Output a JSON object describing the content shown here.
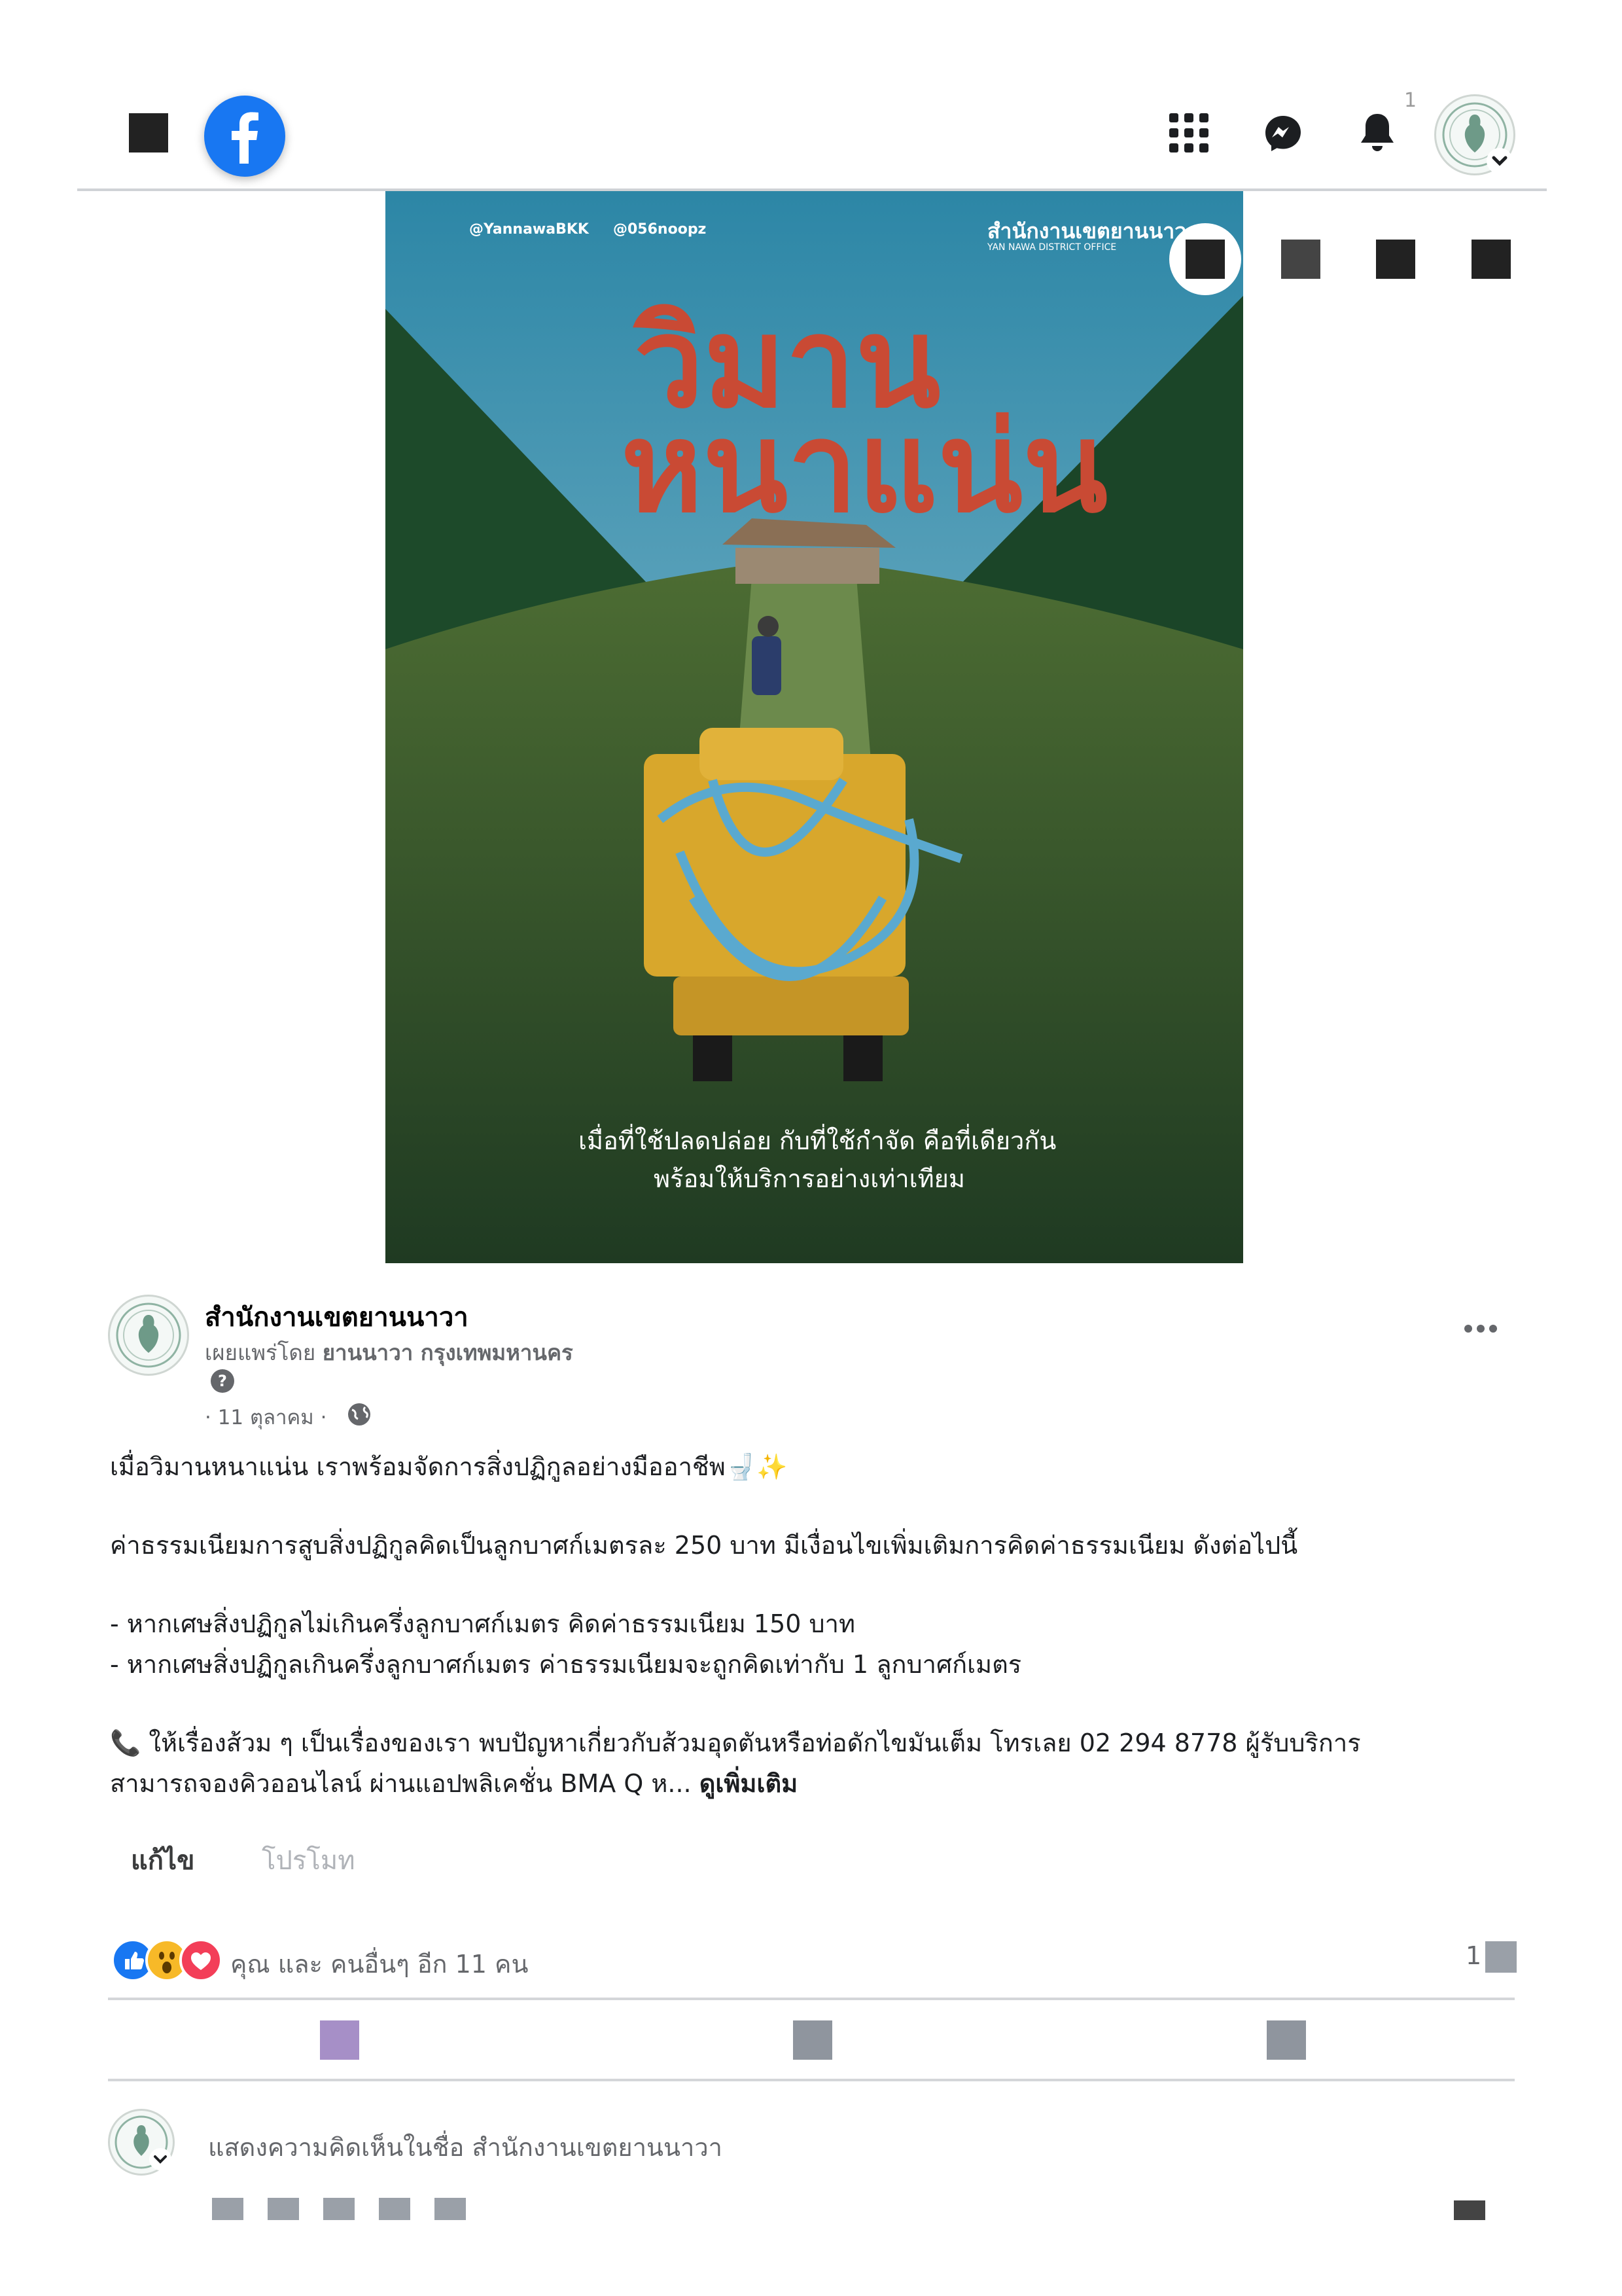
{
  "header": {
    "logo_icon": "facebook-logo-icon",
    "notification_count": "1",
    "icons": [
      "menu-grid-icon",
      "messenger-icon",
      "bell-icon",
      "account-chevron-icon"
    ]
  },
  "poster": {
    "social_handle": "@YannawaBKK",
    "line_handle": "@056noopz",
    "office_th": "สำนักงานเขตยานนาวา",
    "office_en": "YAN NAWA DISTRICT OFFICE",
    "title_line1": "วิมาน",
    "title_line2": "หนาแน่น",
    "caption_line1": "เมื่อที่ใช้ปลดปล่อย กับที่ใช้กำจัด คือที่เดียวกัน",
    "caption_line2": "พร้อมให้บริการอย่างเท่าเทียม"
  },
  "post": {
    "page_name": "สำนักงานเขตยานนาวา",
    "posted_by_prefix": "เผยแพร่โดย",
    "posted_by_name": "ยานนาวา กรุงเทพมหานคร",
    "date": "· 11 ตุลาคม ·",
    "body": [
      "เมื่อวิมานหนาแน่น เราพร้อมจัดการสิ่งปฏิกูลอย่างมืออาชีพ🚽✨",
      "ค่าธรรมเนียมการสูบสิ่งปฏิกูลคิดเป็นลูกบาศก์เมตรละ 250 บาท มีเงื่อนไขเพิ่มเติมการคิดค่าธรรมเนียม ดังต่อไปนี้",
      "- หากเศษสิ่งปฏิกูลไม่เกินครึ่งลูกบาศก์เมตร คิดค่าธรรมเนียม 150 บาท",
      "- หากเศษสิ่งปฏิกูลเกินครึ่งลูกบาศก์เมตร ค่าธรรมเนียมจะถูกคิดเท่ากับ 1 ลูกบาศก์เมตร",
      "📞 ให้เรื่องส้วม ๆ เป็นเรื่องของเรา พบปัญหาเกี่ยวกับส้วมอุดตันหรือท่อดักไขมันเต็ม โทรเลย  02 294 8778 ผู้รับบริการ",
      "สามารถจองคิวออนไลน์ ผ่านแอปพลิเคชั่น BMA Q ห..."
    ],
    "see_more": "ดูเพิ่มเติม",
    "edit_label": "แก้ไข",
    "promote_label": "โปรโมท",
    "reactions_text": "คุณ และ คนอื่นๆ อีก 11 คน",
    "comment_count": "1",
    "comment_placeholder": "แสดงความคิดเห็นในชื่อ สำนักงานเขตยานนาวา"
  }
}
